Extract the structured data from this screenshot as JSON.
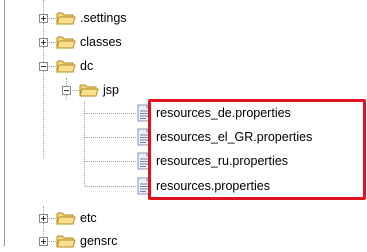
{
  "tree": {
    "items": [
      {
        "label": ".settings",
        "type": "folder",
        "state": "collapsed"
      },
      {
        "label": "classes",
        "type": "folder",
        "state": "collapsed"
      },
      {
        "label": "dc",
        "type": "folder",
        "state": "expanded"
      },
      {
        "label": "jsp",
        "type": "folder",
        "state": "expanded"
      },
      {
        "label": "resources_de.properties",
        "type": "file"
      },
      {
        "label": "resources_el_GR.properties",
        "type": "file"
      },
      {
        "label": "resources_ru.properties",
        "type": "file"
      },
      {
        "label": "resources.properties",
        "type": "file"
      },
      {
        "label": "etc",
        "type": "folder",
        "state": "collapsed"
      },
      {
        "label": "gensrc",
        "type": "folder",
        "state": "collapsed"
      }
    ]
  },
  "colors": {
    "highlight": "#e0141e",
    "folder": "#f2cf63",
    "file": "#c9d8ee"
  },
  "icons": {
    "folder": "folder-icon",
    "file": "properties-file-icon",
    "expand": "expand-plus-icon",
    "collapse": "collapse-minus-icon"
  }
}
